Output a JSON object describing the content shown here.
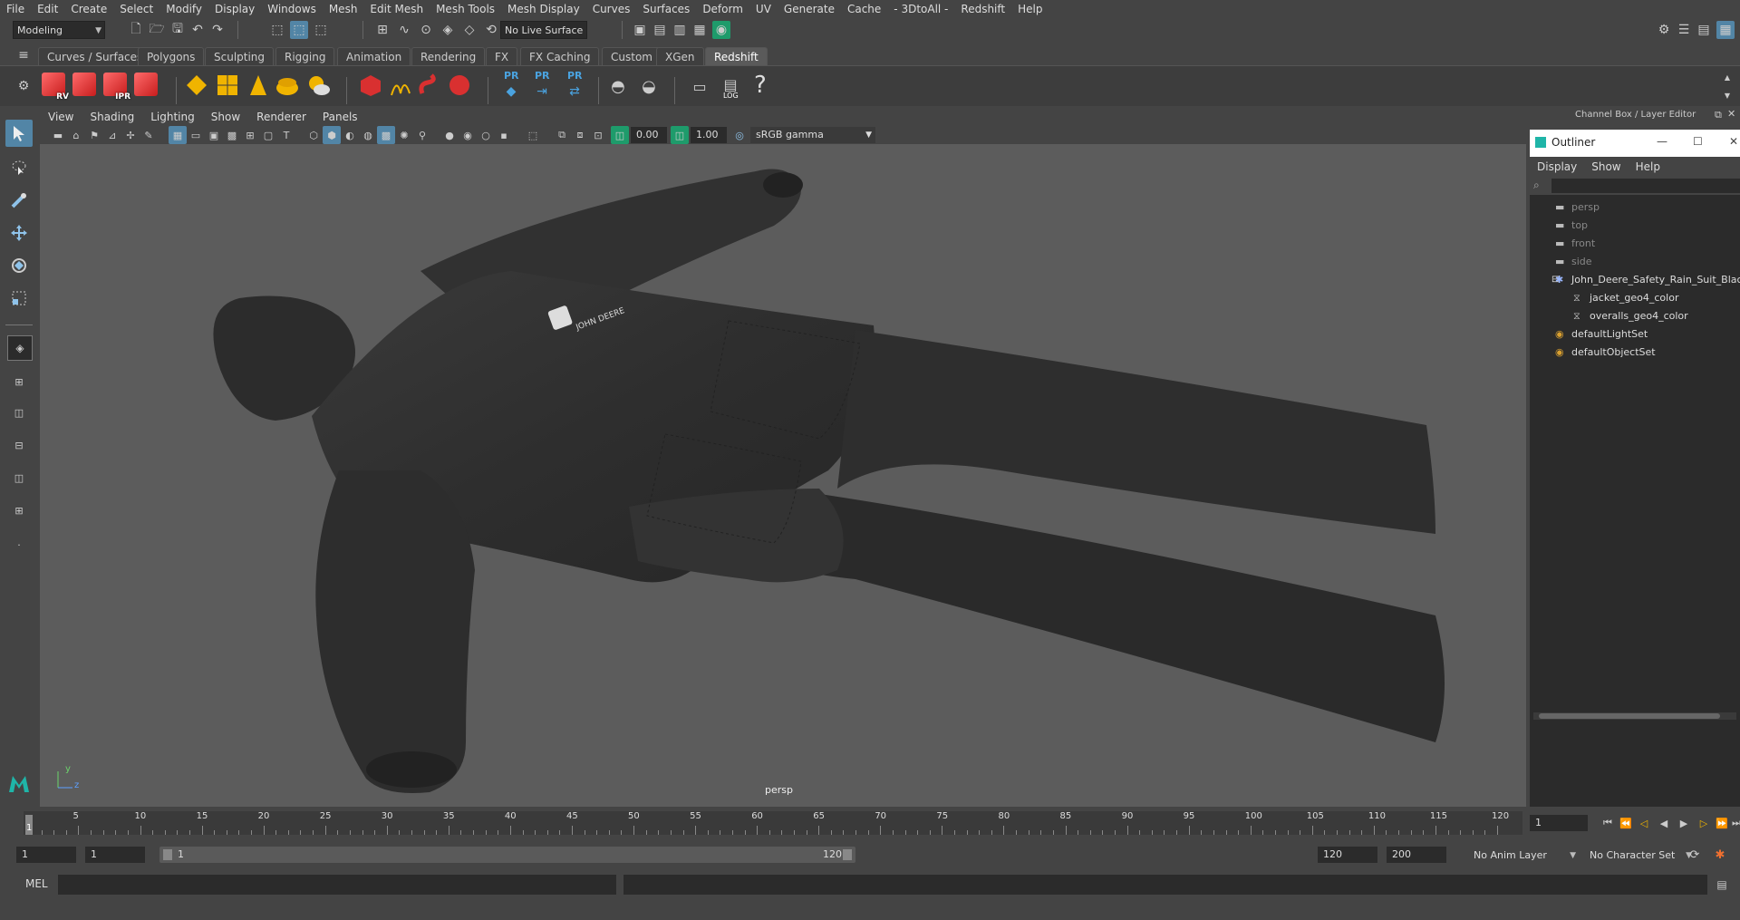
{
  "menubar": {
    "items": [
      "File",
      "Edit",
      "Create",
      "Select",
      "Modify",
      "Display",
      "Windows",
      "Mesh",
      "Edit Mesh",
      "Mesh Tools",
      "Mesh Display",
      "Curves",
      "Surfaces",
      "Deform",
      "UV",
      "Generate",
      "Cache",
      "- 3DtoAll -",
      "Redshift",
      "Help"
    ]
  },
  "statusline": {
    "mode": "Modeling",
    "live_surface": "No Live Surface"
  },
  "shelf": {
    "tabs": [
      "Curves / Surfaces",
      "Polygons",
      "Sculpting",
      "Rigging",
      "Animation",
      "Rendering",
      "FX",
      "FX Caching",
      "Custom",
      "XGen",
      "Redshift"
    ],
    "active_tab": "Redshift",
    "redshift_icons": [
      "RV",
      "IPR"
    ],
    "pr_labels": [
      "PR",
      "PR",
      "PR"
    ],
    "log_label": "LOG",
    "help_glyph": "?"
  },
  "viewport": {
    "menu": [
      "View",
      "Shading",
      "Lighting",
      "Show",
      "Renderer",
      "Panels"
    ],
    "exposure": "0.00",
    "gamma": "1.00",
    "color_space": "sRGB gamma",
    "camera": "persp",
    "logo_text": "JOHN DEERE",
    "axis_y": "y",
    "axis_z": "z"
  },
  "channel_box": {
    "title": "Channel Box / Layer Editor"
  },
  "outliner": {
    "title": "Outliner",
    "menu": [
      "Display",
      "Show",
      "Help"
    ],
    "items": [
      {
        "label": "persp",
        "type": "camera"
      },
      {
        "label": "top",
        "type": "camera"
      },
      {
        "label": "front",
        "type": "camera"
      },
      {
        "label": "side",
        "type": "camera"
      },
      {
        "label": "John_Deere_Safety_Rain_Suit_Black",
        "type": "group"
      },
      {
        "label": "jacket_geo4_color",
        "type": "mesh"
      },
      {
        "label": "overalls_geo4_color",
        "type": "mesh"
      },
      {
        "label": "defaultLightSet",
        "type": "set"
      },
      {
        "label": "defaultObjectSet",
        "type": "set"
      }
    ]
  },
  "timeline": {
    "ticks": [
      5,
      10,
      15,
      20,
      25,
      30,
      35,
      40,
      45,
      50,
      55,
      60,
      65,
      70,
      75,
      80,
      85,
      90,
      95,
      100,
      105,
      110,
      115,
      120
    ],
    "current_frame": "1",
    "start_marker": "1",
    "current_field": "1"
  },
  "range": {
    "start": "1",
    "playback_start": "1",
    "slider_start": "1",
    "slider_end": "120",
    "playback_end": "120",
    "end": "200",
    "anim_layer": "No Anim Layer",
    "character_set": "No Character Set"
  },
  "cmdline": {
    "label": "MEL"
  },
  "colors": {
    "accent": "#5285a6",
    "viewport_bg": "#5c5c5c",
    "redshift_red": "#d93030",
    "shelf_yellow": "#f0b400"
  }
}
